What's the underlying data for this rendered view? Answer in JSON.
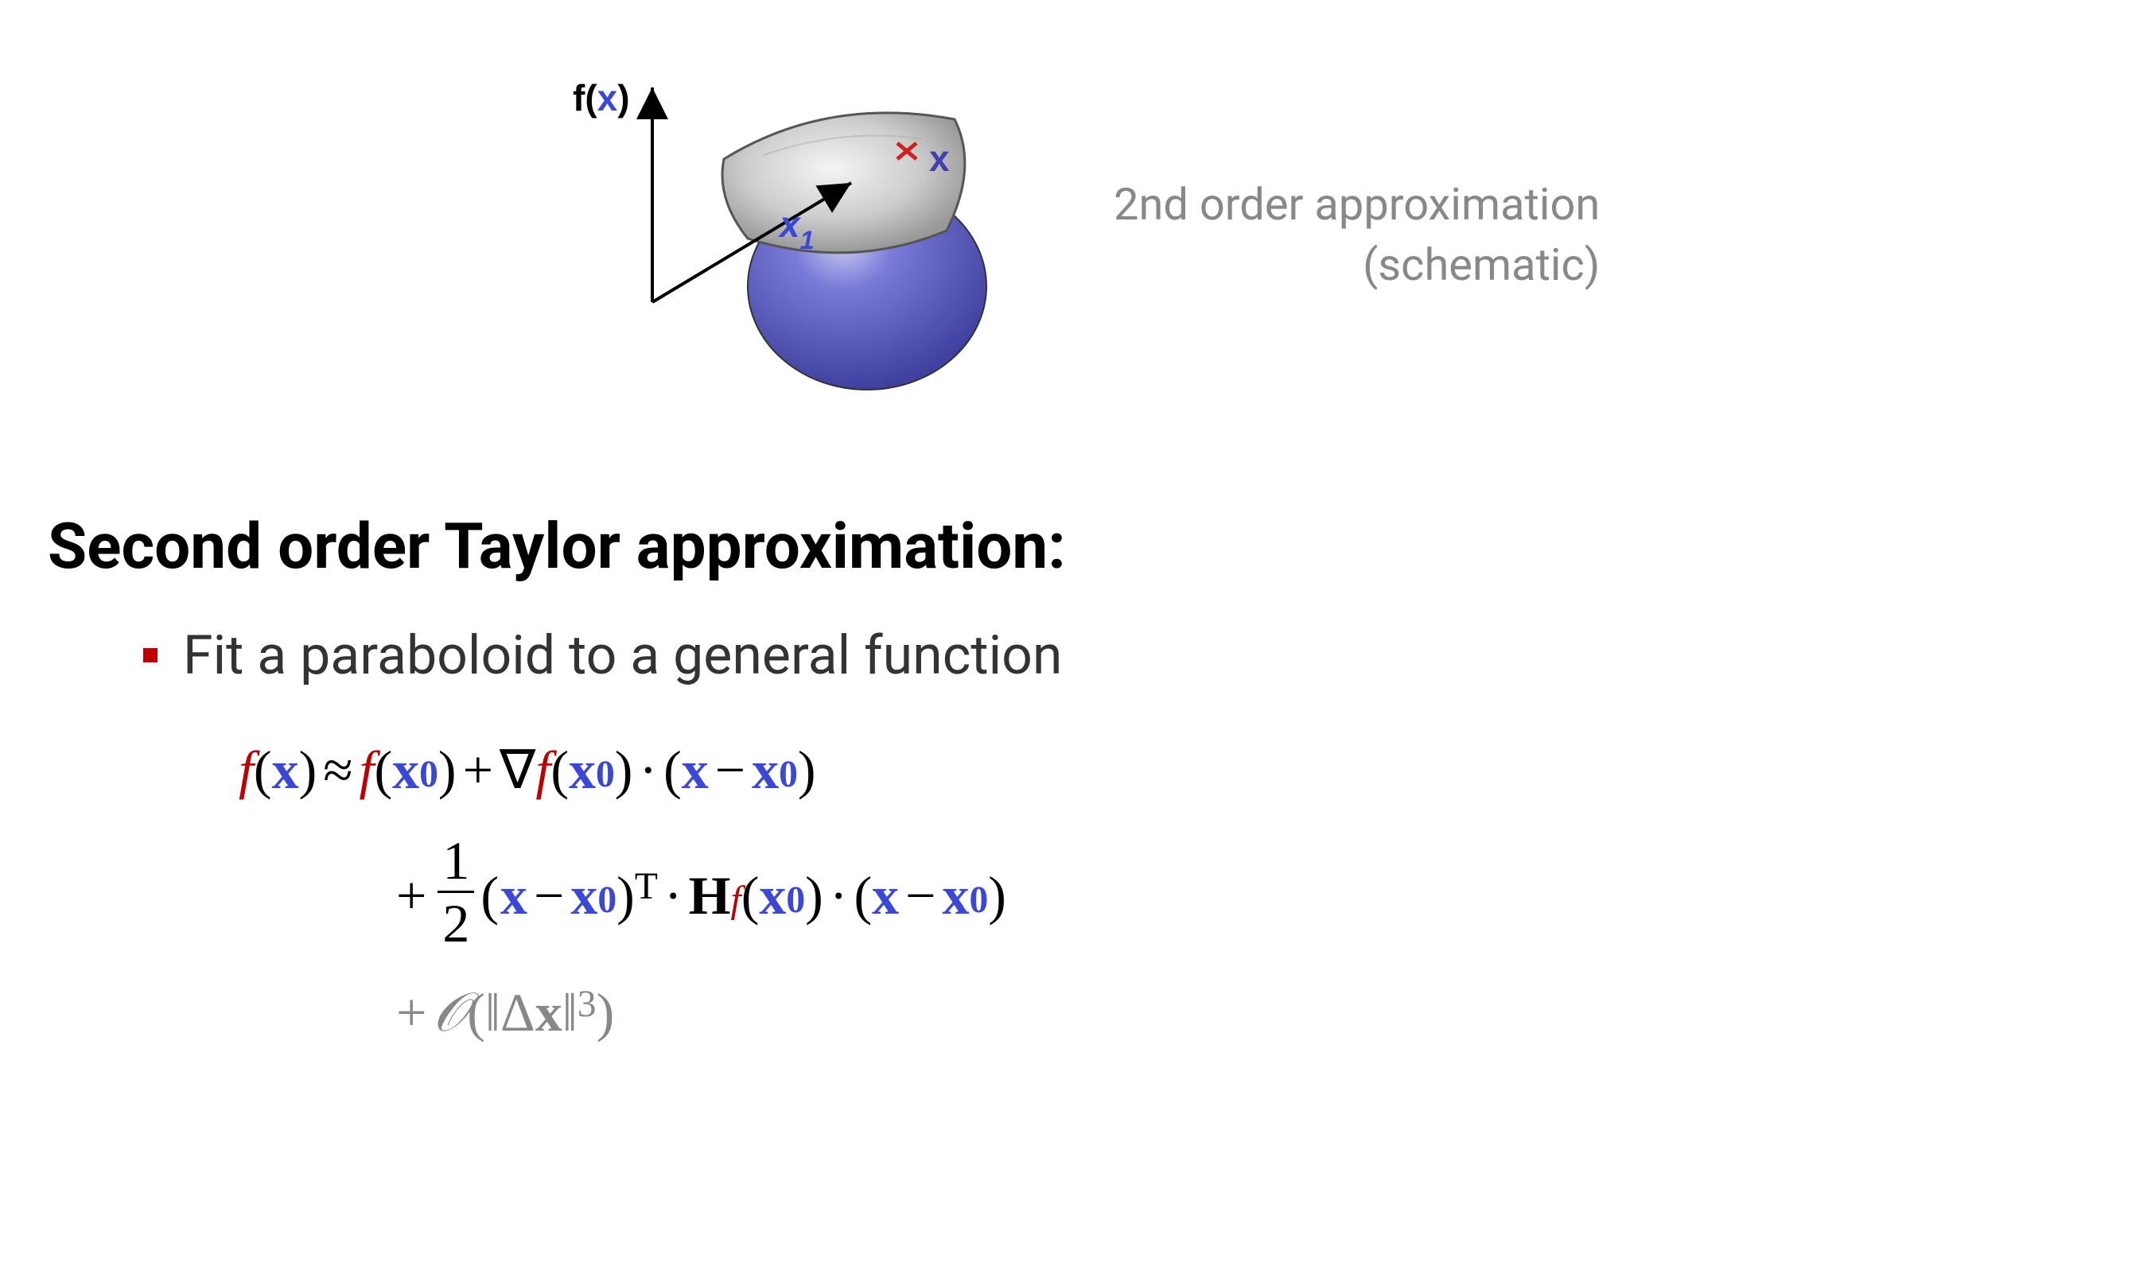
{
  "schematic": {
    "y_axis_label_f": "f(",
    "y_axis_label_x": "x",
    "y_axis_label_close": ")",
    "x1_label_x": "x",
    "x1_label_sub": "1",
    "x2_label": "x",
    "marker_glyph": "✕"
  },
  "caption": {
    "line1": "2nd order approximation",
    "line2": "(schematic)"
  },
  "heading": "Second order Taylor approximation:",
  "bullet": "Fit a paraboloid to a general function",
  "eq": {
    "f": "f",
    "x": "x",
    "zero": "0",
    "approx": "≈",
    "plus": "+",
    "nabla": "∇",
    "dot": "·",
    "minus": "−",
    "lp": "(",
    "rp": ")",
    "frac_num": "1",
    "frac_den": "2",
    "T": "T",
    "H": "H",
    "bigO": "𝒪",
    "ldbar": "‖",
    "delta": "Δ",
    "three": "3"
  }
}
